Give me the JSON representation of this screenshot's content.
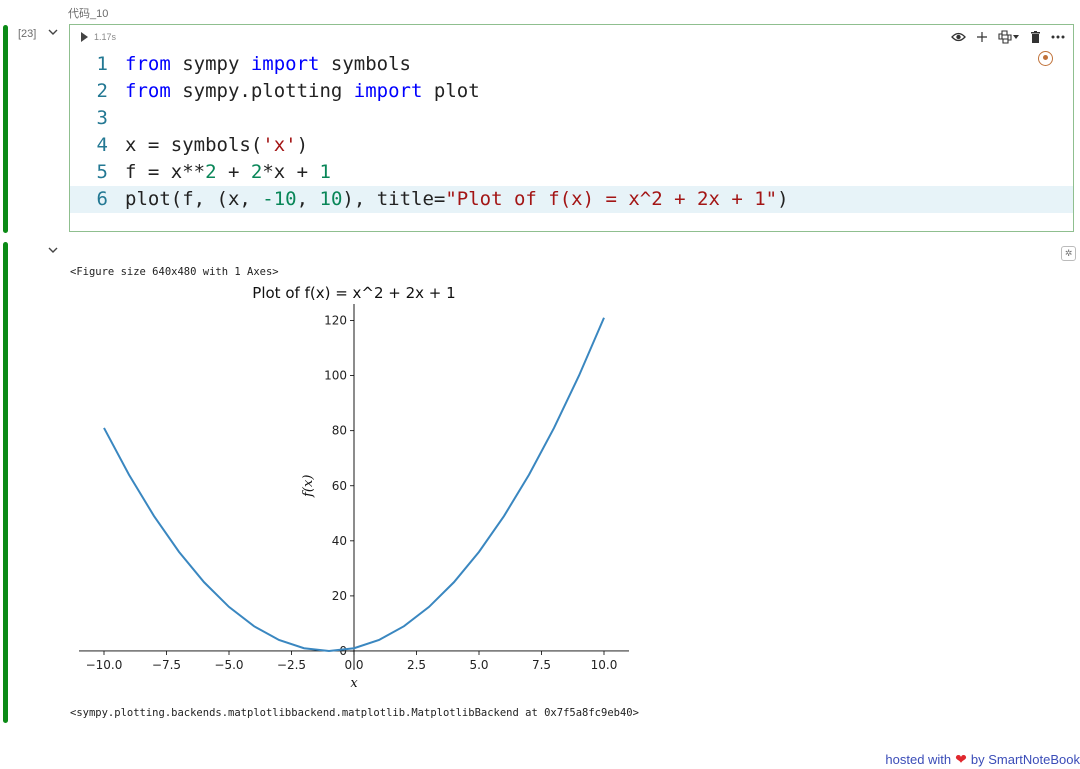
{
  "cell": {
    "label": "代码_10",
    "exec_count": "[23]",
    "run_time": "1.17s"
  },
  "code_lines": [
    {
      "n": "1",
      "tokens": [
        [
          "kw",
          "from"
        ],
        [
          "t",
          " sympy "
        ],
        [
          "kw",
          "import"
        ],
        [
          "t",
          " symbols"
        ]
      ]
    },
    {
      "n": "2",
      "tokens": [
        [
          "kw",
          "from"
        ],
        [
          "t",
          " sympy.plotting "
        ],
        [
          "kw",
          "import"
        ],
        [
          "t",
          " plot"
        ]
      ]
    },
    {
      "n": "3",
      "tokens": []
    },
    {
      "n": "4",
      "tokens": [
        [
          "t",
          "x = symbols("
        ],
        [
          "str",
          "'x'"
        ],
        [
          "t",
          ")"
        ]
      ]
    },
    {
      "n": "5",
      "tokens": [
        [
          "t",
          "f = x**"
        ],
        [
          "num",
          "2"
        ],
        [
          "t",
          " + "
        ],
        [
          "num",
          "2"
        ],
        [
          "t",
          "*x + "
        ],
        [
          "num",
          "1"
        ]
      ]
    },
    {
      "n": "6",
      "tokens": [
        [
          "t",
          "plot(f, (x, "
        ],
        [
          "num",
          "-10"
        ],
        [
          "t",
          ", "
        ],
        [
          "num",
          "10"
        ],
        [
          "t",
          "), title="
        ],
        [
          "str",
          "\"Plot of f(x) = x^2 + 2x + 1\""
        ],
        [
          "t",
          ")"
        ]
      ]
    }
  ],
  "toolbar": {
    "icons": [
      "eye-icon",
      "plus-icon",
      "python-icon",
      "dropdown-icon",
      "trash-icon",
      "more-icon"
    ]
  },
  "output": {
    "figure_text": "<Figure size 640x480 with 1 Axes>",
    "backend_text": "<sympy.plotting.backends.matplotlibbackend.matplotlib.MatplotlibBackend at 0x7f5a8fc9eb40>"
  },
  "footer": {
    "prefix": "hosted with",
    "suffix": "by SmartNoteBook"
  },
  "colors": {
    "accent_green": "#0b8a16",
    "line_color": "#3a87c0",
    "link": "#3b4db8",
    "heart": "#e0282e"
  },
  "chart_data": {
    "type": "line",
    "title": "Plot of f(x) = x^2 + 2x + 1",
    "xlabel": "x",
    "ylabel": "f(x)",
    "function": "x^2 + 2x + 1",
    "xlim": [
      -11,
      11
    ],
    "ylim": [
      -4,
      126
    ],
    "xticks": [
      -10,
      -7.5,
      -5,
      -2.5,
      0,
      2.5,
      5,
      7.5,
      10
    ],
    "xtick_labels": [
      "−10.0",
      "−7.5",
      "−5.0",
      "−2.5",
      "0.0",
      "2.5",
      "5.0",
      "7.5",
      "10.0"
    ],
    "yticks": [
      0,
      20,
      40,
      60,
      80,
      100,
      120
    ],
    "ytick_labels": [
      "0",
      "20",
      "40",
      "60",
      "80",
      "100",
      "120"
    ],
    "series": [
      {
        "x": [
          -10,
          -9,
          -8,
          -7,
          -6,
          -5,
          -4,
          -3,
          -2,
          -1,
          0,
          1,
          2,
          3,
          4,
          5,
          6,
          7,
          8,
          9,
          10
        ],
        "y": [
          81,
          64,
          49,
          36,
          25,
          16,
          9,
          4,
          1,
          0,
          1,
          4,
          9,
          16,
          25,
          36,
          49,
          64,
          81,
          100,
          121
        ]
      }
    ],
    "grid": false,
    "legend": "none"
  }
}
